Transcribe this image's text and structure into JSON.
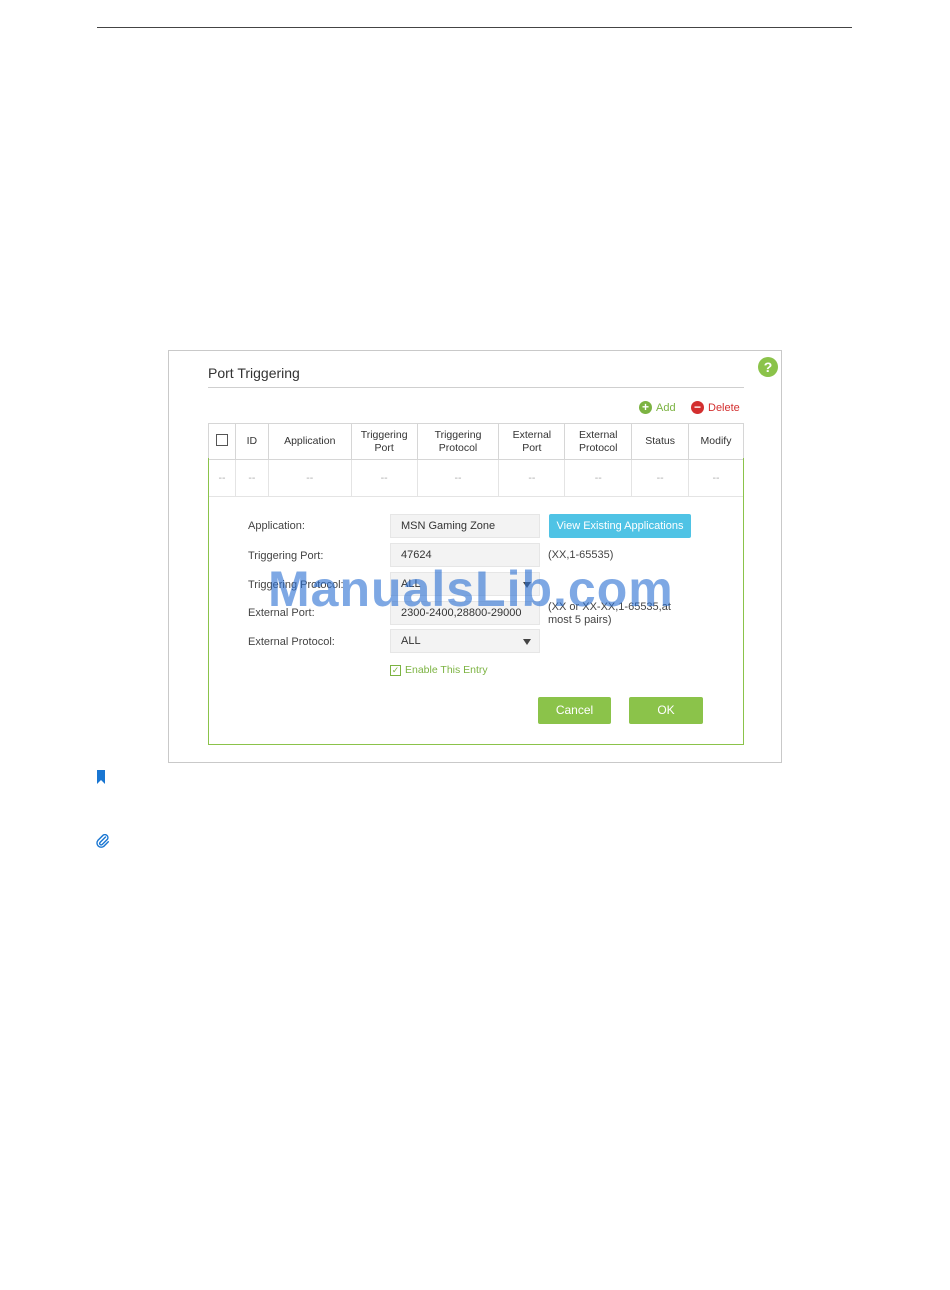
{
  "panel": {
    "title": "Port Triggering",
    "help_glyph": "?"
  },
  "actions": {
    "add_label": "Add",
    "delete_label": "Delete"
  },
  "table": {
    "headers": [
      "ID",
      "Application",
      "Triggering\nPort",
      "Triggering\nProtocol",
      "External\nPort",
      "External\nProtocol",
      "Status",
      "Modify"
    ],
    "row": [
      "--",
      "--",
      "--",
      "--",
      "--",
      "--",
      "--",
      "--",
      "--"
    ]
  },
  "form": {
    "application_label": "Application:",
    "application_value": "MSN Gaming Zone",
    "view_button": "View Existing Applications",
    "triggering_port_label": "Triggering Port:",
    "triggering_port_value": "47624",
    "triggering_port_hint": "(XX,1-65535)",
    "triggering_protocol_label": "Triggering Protocol:",
    "triggering_protocol_value": "ALL",
    "external_port_label": "External Port:",
    "external_port_value": "2300-2400,28800-29000",
    "external_port_hint": "(XX or XX-XX,1-65535,at most 5 pairs)",
    "external_protocol_label": "External Protocol:",
    "external_protocol_value": "ALL",
    "enable_label": "Enable This Entry",
    "cancel_label": "Cancel",
    "ok_label": "OK"
  },
  "watermark": "ManualsLib.com",
  "colors": {
    "accent_green": "#8bc34a",
    "delete_red": "#d32f2f",
    "button_blue": "#4fc3e5"
  }
}
